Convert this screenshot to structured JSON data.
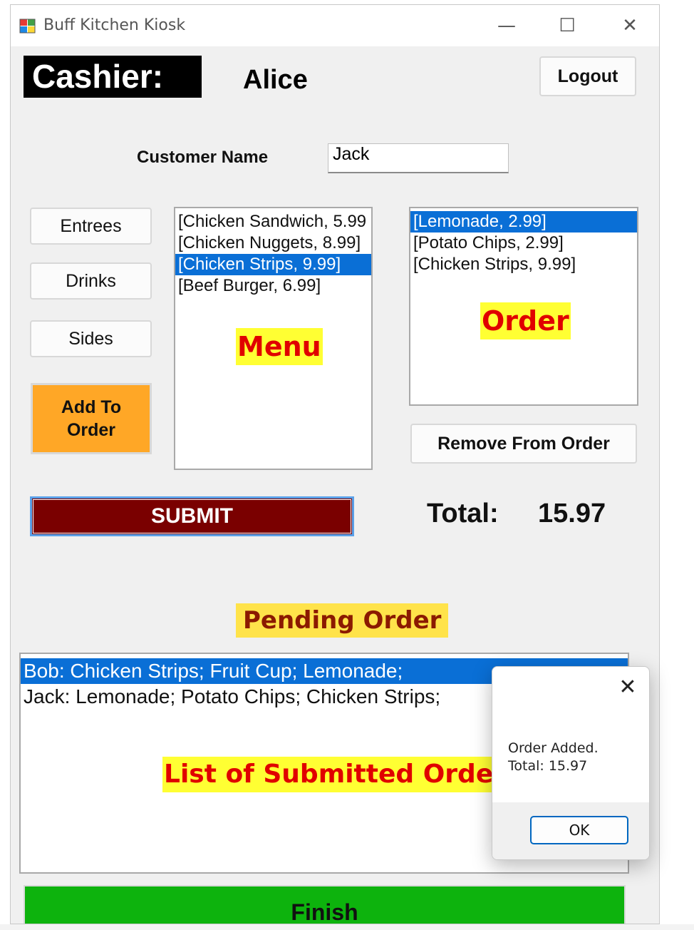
{
  "window": {
    "title": "Buff Kitchen Kiosk",
    "controls": {
      "minimize": "—",
      "maximize": "☐",
      "close": "✕"
    }
  },
  "header": {
    "cashier_label": "Cashier:",
    "cashier_name": "Alice",
    "logout_label": "Logout"
  },
  "customer": {
    "label": "Customer Name",
    "value": "Jack"
  },
  "categories": {
    "entrees": "Entrees",
    "drinks": "Drinks",
    "sides": "Sides"
  },
  "add_to_order": {
    "line1": "Add To",
    "line2": "Order"
  },
  "menu": {
    "annotation": "Menu",
    "items": [
      {
        "label": "[Chicken Sandwich, 5.99",
        "selected": false
      },
      {
        "label": "[Chicken Nuggets, 8.99]",
        "selected": false
      },
      {
        "label": "[Chicken Strips, 9.99]",
        "selected": true
      },
      {
        "label": "[Beef Burger, 6.99]",
        "selected": false
      }
    ]
  },
  "order": {
    "annotation": "Order",
    "items": [
      {
        "label": "[Lemonade, 2.99]",
        "selected": true
      },
      {
        "label": "[Potato Chips, 2.99]",
        "selected": false
      },
      {
        "label": "[Chicken Strips, 9.99]",
        "selected": false
      }
    ],
    "remove_label": "Remove From Order"
  },
  "submit_label": "SUBMIT",
  "total": {
    "label": "Total:",
    "value": "15.97"
  },
  "pending": {
    "heading": "Pending Order",
    "annotation": "List of Submitted Orders",
    "items": [
      {
        "label": "Bob: Chicken Strips; Fruit Cup; Lemonade;",
        "selected": true
      },
      {
        "label": "Jack: Lemonade; Potato Chips; Chicken Strips;",
        "selected": false
      }
    ]
  },
  "finish_label": "Finish",
  "dialog": {
    "close": "✕",
    "message_line1": "Order Added.",
    "message_line2": "Total: 15.97",
    "ok_label": "OK"
  },
  "colors": {
    "submit": "#7a0000",
    "add_to_order": "#ffa726",
    "finish": "#0db30d",
    "selection": "#0a6fd6",
    "annotation_bg": "#ffff33",
    "annotation_text": "#e00000"
  }
}
